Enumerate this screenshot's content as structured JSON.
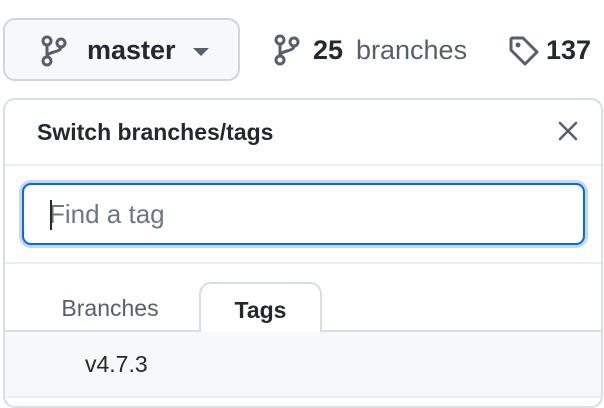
{
  "branch_selector": {
    "current_branch": "master",
    "icon": "git-branch-icon"
  },
  "branches_link": {
    "count": "25",
    "label": "branches",
    "icon": "git-branch-icon"
  },
  "tags_link": {
    "count": "137",
    "icon": "tag-icon"
  },
  "dropdown": {
    "title": "Switch branches/tags",
    "close_icon": "close-icon",
    "filter": {
      "value": "",
      "placeholder": "Find a tag"
    },
    "tabs": [
      {
        "label": "Branches",
        "selected": false
      },
      {
        "label": "Tags",
        "selected": true
      }
    ],
    "items": [
      {
        "label": "v4.7.3"
      }
    ]
  },
  "colors": {
    "accent": "#0969da",
    "text": "#24292f",
    "muted": "#57606a",
    "border": "#d8dee4"
  }
}
